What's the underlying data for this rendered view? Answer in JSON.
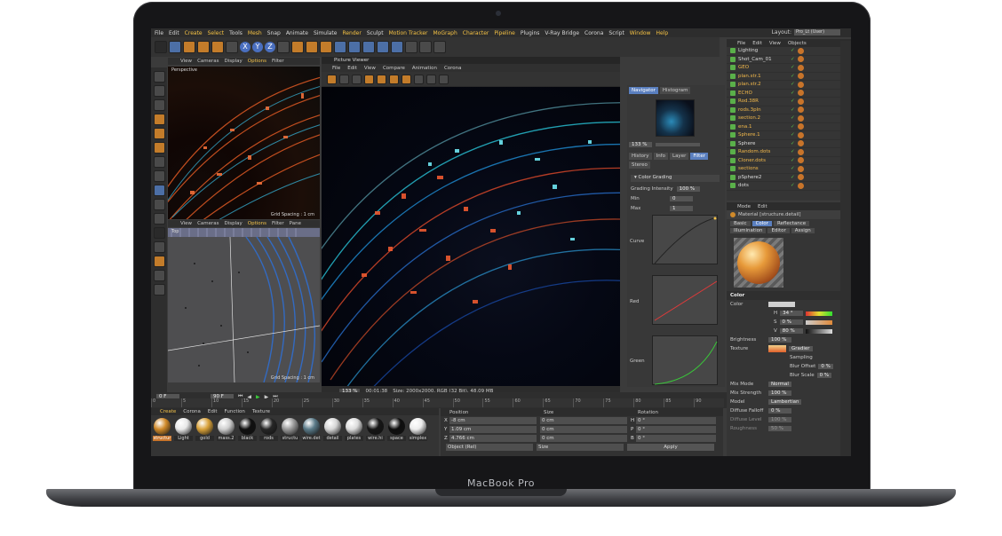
{
  "device": {
    "brand": "MacBook Pro"
  },
  "menubar": {
    "items": [
      {
        "label": "File",
        "hl": false
      },
      {
        "label": "Edit",
        "hl": false
      },
      {
        "label": "Create",
        "hl": true
      },
      {
        "label": "Select",
        "hl": true
      },
      {
        "label": "Tools",
        "hl": false
      },
      {
        "label": "Mesh",
        "hl": true
      },
      {
        "label": "Snap",
        "hl": false
      },
      {
        "label": "Animate",
        "hl": false
      },
      {
        "label": "Simulate",
        "hl": false
      },
      {
        "label": "Render",
        "hl": true
      },
      {
        "label": "Sculpt",
        "hl": false
      },
      {
        "label": "Motion Tracker",
        "hl": true
      },
      {
        "label": "MoGraph",
        "hl": true
      },
      {
        "label": "Character",
        "hl": true
      },
      {
        "label": "Pipeline",
        "hl": true
      },
      {
        "label": "Plugins",
        "hl": false
      },
      {
        "label": "V-Ray Bridge",
        "hl": false
      },
      {
        "label": "Corona",
        "hl": false
      },
      {
        "label": "Script",
        "hl": false
      },
      {
        "label": "Window",
        "hl": true
      },
      {
        "label": "Help",
        "hl": true
      }
    ],
    "layout_label": "Layout:",
    "layout_value": "Pro_Lt (User)"
  },
  "toolbar": {
    "axis_x": "X",
    "axis_y": "Y",
    "axis_z": "Z"
  },
  "viewport_top": {
    "menu": [
      "View",
      "Cameras",
      "Display",
      "Options",
      "Filter"
    ],
    "active": "Options",
    "label": "Perspective",
    "grid": "Grid Spacing : 1 cm"
  },
  "viewport_bottom": {
    "menu": [
      "View",
      "Cameras",
      "Display",
      "Options",
      "Filter",
      "Pane"
    ],
    "active": "Options",
    "label": "Top",
    "grid": "Grid Spacing : 1 cm"
  },
  "picture_viewer": {
    "title": "Picture Viewer",
    "menu": [
      "File",
      "Edit",
      "View",
      "Compare",
      "Animation",
      "Corona"
    ],
    "zoom": "133 %",
    "time": "00:01:38",
    "size_info": "Size: 2000x2000, RGB (32 Bit), 48.09 MB"
  },
  "navigator": {
    "tabs": [
      "Navigator",
      "Histogram"
    ],
    "zoom": "133 %",
    "tabs2": [
      "History",
      "Info",
      "Layer",
      "Filter",
      "Stereo"
    ],
    "active2": "Filter",
    "color_grading": "Color Grading",
    "grading_label": "Grading Intensity",
    "grading_value": "100 %",
    "min_label": "Min",
    "min_value": "0",
    "max_label": "Max",
    "max_value": "1",
    "curve_label": "Curve",
    "red_label": "Red",
    "green_label": "Green",
    "curve_ticks": [
      "0.8",
      "0.4",
      "0.4",
      "0.8"
    ]
  },
  "timeline": {
    "start": "0 F",
    "end": "90 F",
    "ruler": [
      "0",
      "5",
      "10",
      "15",
      "20",
      "25",
      "30",
      "35",
      "40",
      "45",
      "50",
      "55",
      "60",
      "65",
      "70",
      "75",
      "80",
      "85",
      "90"
    ]
  },
  "material_manager": {
    "menu": [
      "Create",
      "Corona",
      "Edit",
      "Function",
      "Texture"
    ],
    "active": "Create",
    "materials": [
      {
        "name": "structur",
        "color": "#d08a2a",
        "sel": true
      },
      {
        "name": "Light",
        "color": "#e8e8e8",
        "sel": false
      },
      {
        "name": "gold",
        "color": "#d9a23a",
        "sel": false
      },
      {
        "name": "mass.2",
        "color": "#cfcfcf",
        "sel": false
      },
      {
        "name": "black",
        "color": "#101010",
        "sel": false
      },
      {
        "name": "rods",
        "color": "#262626",
        "sel": false
      },
      {
        "name": "structu",
        "color": "#9a9a9a",
        "sel": false
      },
      {
        "name": "wire.det",
        "color": "#5a7a88",
        "sel": false
      },
      {
        "name": "detail",
        "color": "#d6d6d6",
        "sel": false
      },
      {
        "name": "plates",
        "color": "#dcdcdc",
        "sel": false
      },
      {
        "name": "wire.hi",
        "color": "#161616",
        "sel": false
      },
      {
        "name": "space",
        "color": "#0e0e0e",
        "sel": false
      },
      {
        "name": "simplex",
        "color": "#ececec",
        "sel": false
      }
    ]
  },
  "coords": {
    "headers": [
      "Position",
      "Size",
      "Rotation"
    ],
    "rows": [
      {
        "axis": "X",
        "pos": "-8 cm",
        "size": "0 cm",
        "rot_axis": "H",
        "rot": "0 °"
      },
      {
        "axis": "Y",
        "pos": "1.09 cm",
        "size": "0 cm",
        "rot_axis": "P",
        "rot": "0 °"
      },
      {
        "axis": "Z",
        "pos": "4.766 cm",
        "size": "0 cm",
        "rot_axis": "B",
        "rot": "0 °"
      }
    ],
    "mode1": "Object (Rel)",
    "mode2": "Size",
    "apply": "Apply"
  },
  "object_manager": {
    "menu": [
      "File",
      "Edit",
      "View",
      "Objects"
    ],
    "objects": [
      {
        "name": "Lighting",
        "y": false
      },
      {
        "name": "Shot_Cam_01",
        "y": false
      },
      {
        "name": "GEO",
        "y": true
      },
      {
        "name": "plan.str.1",
        "y": true
      },
      {
        "name": "plan.str.2",
        "y": true
      },
      {
        "name": "ECHO",
        "y": true
      },
      {
        "name": "Rod.38R",
        "y": true
      },
      {
        "name": "rods.3pln",
        "y": true
      },
      {
        "name": "section.2",
        "y": true
      },
      {
        "name": "ena.1",
        "y": true
      },
      {
        "name": "Sphere.1",
        "y": true
      },
      {
        "name": "Sphere",
        "y": false
      },
      {
        "name": "Random.dots",
        "y": true
      },
      {
        "name": "Cloner.dots",
        "y": true
      },
      {
        "name": "sections",
        "y": true
      },
      {
        "name": "pSphere2",
        "y": false
      },
      {
        "name": "dots",
        "y": false
      }
    ]
  },
  "attributes": {
    "menu": [
      "Mode",
      "Edit"
    ],
    "title": "Material [structure.detail]",
    "tabs": [
      "Basic",
      "Color",
      "Reflectance",
      "Illumination",
      "Editor",
      "Assign"
    ],
    "active": "Color",
    "section": "Color",
    "color_label": "Color",
    "h_label": "H",
    "h_value": "34 °",
    "s_label": "S",
    "s_value": "0 %",
    "v_label": "V",
    "v_value": "80 %",
    "brightness_label": "Brightness",
    "brightness_value": "100 %",
    "texture_label": "Texture",
    "texture_value": "Gradier",
    "sampling_label": "Sampling",
    "blur_offset_label": "Blur Offset",
    "blur_offset_value": "0 %",
    "blur_scale_label": "Blur Scale",
    "blur_scale_value": "0 %",
    "mix_mode_label": "Mix Mode",
    "mix_mode_value": "Normal",
    "mix_strength_label": "Mix Strength",
    "mix_strength_value": "100 %",
    "model_label": "Model",
    "model_value": "Lambertian",
    "diffuse_falloff_label": "Diffuse Falloff",
    "diffuse_falloff_value": "0 %",
    "diffuse_level_label": "Diffuse Level",
    "diffuse_level_value": "100 %",
    "roughness_label": "Roughness",
    "roughness_value": "50 %"
  },
  "colors": {
    "accent": "#f2c24a",
    "select_blue": "#5a7fbf",
    "material_orange": "#c8742a"
  }
}
